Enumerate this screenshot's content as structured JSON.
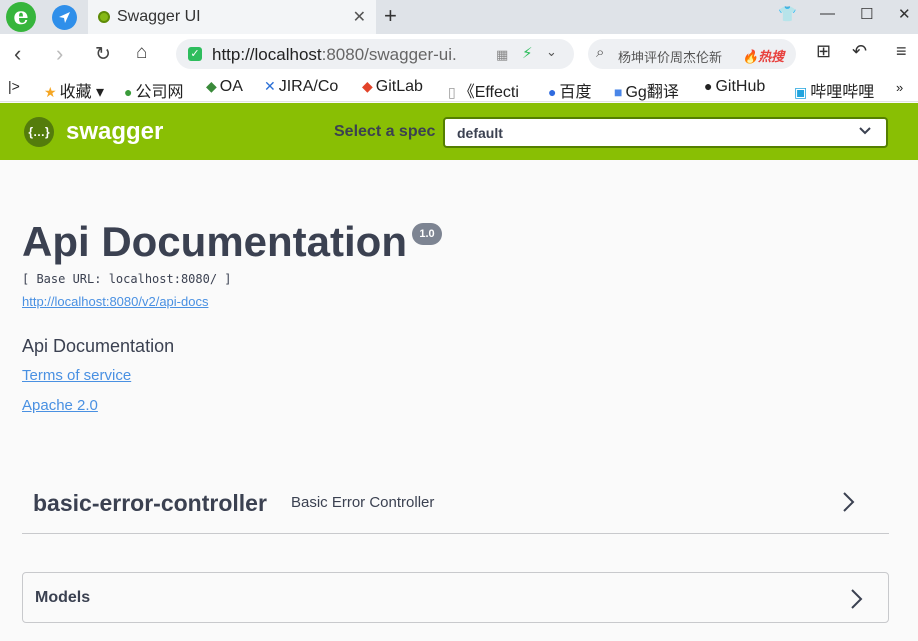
{
  "browser": {
    "tab_title": "Swagger UI",
    "tab_close": "✕",
    "new_tab": "+",
    "url_host": "http://localhost",
    "url_rest": ":8080/swagger-ui.",
    "search_text": "杨坤评价周杰伦新",
    "hot_label": "🔥热搜"
  },
  "bookmarks": [
    {
      "label": "收藏",
      "icon": "★",
      "color": "#f5a623"
    },
    {
      "label": "公司网",
      "icon": "●",
      "color": "#3a9b3a"
    },
    {
      "label": "OA",
      "icon": "◆",
      "color": "#3a8a3a"
    },
    {
      "label": "JIRA/Co",
      "icon": "✕",
      "color": "#2a6fd6"
    },
    {
      "label": "GitLab",
      "icon": "◆",
      "color": "#e24329"
    },
    {
      "label": "《Effecti",
      "icon": "▯",
      "color": "#999999"
    },
    {
      "label": "百度",
      "icon": "●",
      "color": "#2f6bdf"
    },
    {
      "label": "Gg翻译",
      "icon": "■",
      "color": "#4a86e8"
    },
    {
      "label": "GitHub",
      "icon": "●",
      "color": "#222222"
    },
    {
      "label": "哔哩哔哩",
      "icon": "▣",
      "color": "#22a4de"
    }
  ],
  "swagger": {
    "brand": "swagger",
    "spec_label": "Select a spec",
    "spec_value": "default",
    "title": "Api Documentation",
    "version": "1.0",
    "base_url": "[ Base URL: localhost:8080/ ]",
    "docs_link": "http://localhost:8080/v2/api-docs",
    "description": "Api Documentation",
    "terms": "Terms of service",
    "license": "Apache 2.0",
    "tag_name": "basic-error-controller",
    "tag_desc": "Basic Error Controller",
    "models": "Models"
  }
}
